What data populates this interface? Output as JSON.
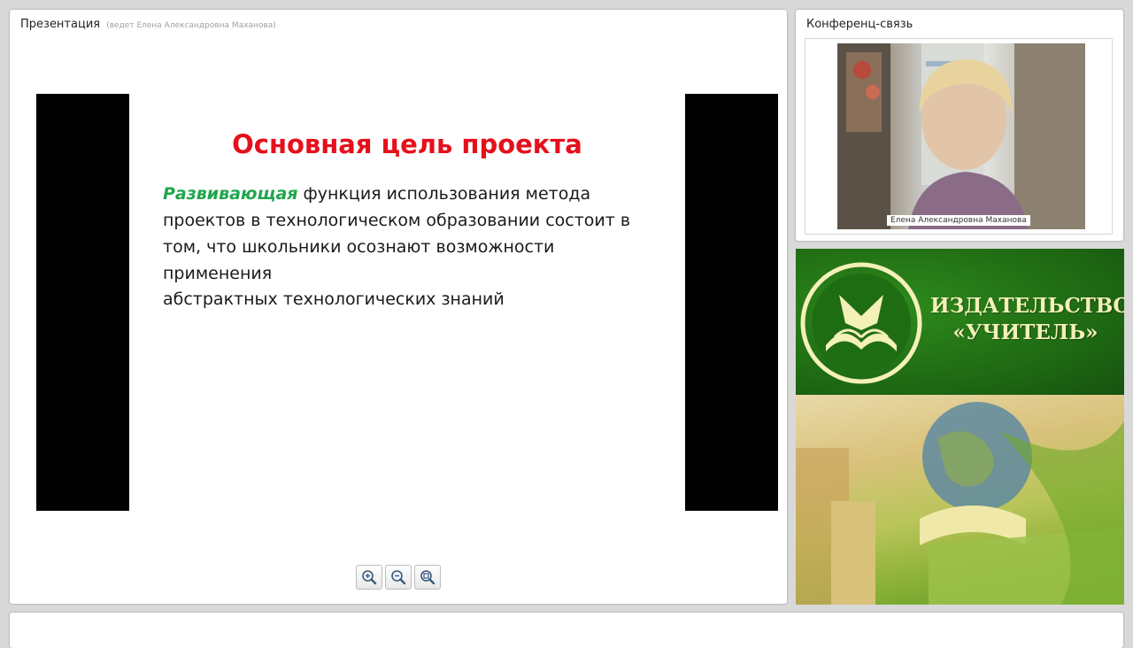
{
  "presentation": {
    "title": "Презентация",
    "presenter_note": "(ведет Елена Александровна Маханова)",
    "slide": {
      "title": "Основная цель проекта",
      "accent_word": "Развивающая",
      "body_rest": " функция использования метода проектов в технологическом образовании состоит в том, что школьники осознают возможности применения",
      "line2": "абстрактных технологических знаний"
    },
    "zoom_buttons": [
      {
        "icon": "zoom-in-icon"
      },
      {
        "icon": "zoom-out-icon"
      },
      {
        "icon": "zoom-fit-icon"
      }
    ]
  },
  "conference": {
    "title": "Конференц-связь",
    "speaker_name": "Елена Александровна Маханова"
  },
  "banner": {
    "publisher_line1": "ИЗДАТЕЛЬСТВО",
    "publisher_line2": "«УЧИТЕЛЬ»",
    "logo": "publisher-logo-icon"
  },
  "colors": {
    "slide_title": "#e5101b",
    "accent": "#1fa64c",
    "banner_green": "#1d6512",
    "banner_text": "#f3f0b8"
  }
}
